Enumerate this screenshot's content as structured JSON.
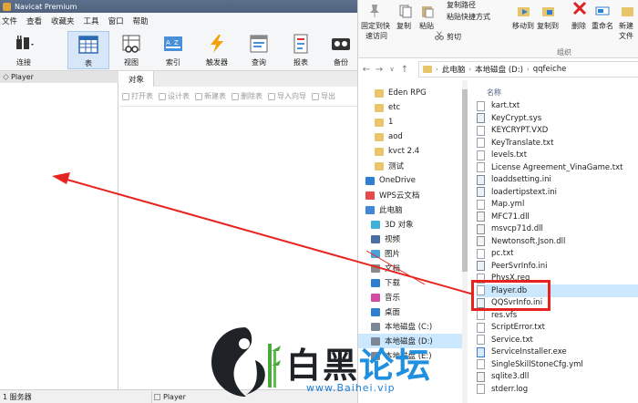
{
  "navicat": {
    "title": "Navicat Premium",
    "menu": [
      "文件",
      "查看",
      "收藏夹",
      "工具",
      "窗口",
      "帮助"
    ],
    "toolbar": [
      {
        "label": "连接",
        "icon": "connection-plug-icon"
      },
      {
        "label": "表",
        "icon": "table-grid-icon",
        "active": true
      },
      {
        "label": "视图",
        "icon": "view-glasses-icon"
      },
      {
        "label": "索引",
        "icon": "index-az-icon"
      },
      {
        "label": "触发器",
        "icon": "trigger-bolt-icon"
      },
      {
        "label": "查询",
        "icon": "query-table-icon"
      },
      {
        "label": "报表",
        "icon": "report-icon"
      },
      {
        "label": "备份",
        "icon": "backup-tape-icon"
      }
    ],
    "connection_tab": "Player",
    "object_tab": "对象",
    "object_actions": [
      "打开表",
      "设计表",
      "新建表",
      "删除表",
      "导入向导",
      "导出"
    ],
    "status": {
      "servers": "1 服务器",
      "db": "Player"
    }
  },
  "explorer": {
    "ribbon": {
      "pin_label_1": "固定到快",
      "pin_label_2": "速访问",
      "copy": "复制",
      "paste": "粘贴",
      "copy_path": "复制路径",
      "paste_shortcut": "粘贴快捷方式",
      "cut": "剪切",
      "move_to": "移动到",
      "copy_to": "复制到",
      "delete": "删除",
      "rename": "重命名",
      "new": "新建",
      "new_sub": "文件",
      "organize": "组织"
    },
    "address": [
      "此电脑",
      "本地磁盘 (D:)",
      "qqfeiche"
    ],
    "nav": [
      {
        "label": "Eden RPG",
        "kind": "folder"
      },
      {
        "label": "etc",
        "kind": "folder"
      },
      {
        "label": "1",
        "kind": "folder"
      },
      {
        "label": "aod",
        "kind": "folder"
      },
      {
        "label": "kvct 2.4",
        "kind": "folder"
      },
      {
        "label": "测试",
        "kind": "folder"
      },
      {
        "label": "OneDrive",
        "kind": "cloud"
      },
      {
        "label": "WPS云文档",
        "kind": "wps"
      },
      {
        "label": "此电脑",
        "kind": "pc"
      },
      {
        "label": "3D 对象",
        "kind": "3d"
      },
      {
        "label": "视频",
        "kind": "video"
      },
      {
        "label": "图片",
        "kind": "picture"
      },
      {
        "label": "文档",
        "kind": "doc"
      },
      {
        "label": "下载",
        "kind": "download"
      },
      {
        "label": "音乐",
        "kind": "music"
      },
      {
        "label": "桌面",
        "kind": "desktop"
      },
      {
        "label": "本地磁盘 (C:)",
        "kind": "drive"
      },
      {
        "label": "本地磁盘 (D:)",
        "kind": "drive",
        "selected": true
      },
      {
        "label": "本地磁盘 (E:)",
        "kind": "drive"
      }
    ],
    "column_name": "名称",
    "files": [
      {
        "name": "kart.txt",
        "type": "txt"
      },
      {
        "name": "KeyCrypt.sys",
        "type": "gear"
      },
      {
        "name": "KEYCRYPT.VXD",
        "type": "txt"
      },
      {
        "name": "KeyTranslate.txt",
        "type": "txt"
      },
      {
        "name": "levels.txt",
        "type": "txt"
      },
      {
        "name": "License Agreement_VinaGame.txt",
        "type": "txt"
      },
      {
        "name": "loaddsetting.ini",
        "type": "gear"
      },
      {
        "name": "loadertipstext.ini",
        "type": "gear"
      },
      {
        "name": "Map.yml",
        "type": "txt"
      },
      {
        "name": "MFC71.dll",
        "type": "dll"
      },
      {
        "name": "msvcp71d.dll",
        "type": "dll"
      },
      {
        "name": "Newtonsoft.Json.dll",
        "type": "dll"
      },
      {
        "name": "pc.txt",
        "type": "txt"
      },
      {
        "name": "PeerSvrInfo.ini",
        "type": "gear"
      },
      {
        "name": "PhysX.reg",
        "type": "txt"
      },
      {
        "name": "Player.db",
        "type": "txt",
        "selected": true
      },
      {
        "name": "QQSvrInfo.ini",
        "type": "gear"
      },
      {
        "name": "res.vfs",
        "type": "txt"
      },
      {
        "name": "ScriptError.txt",
        "type": "txt"
      },
      {
        "name": "Service.txt",
        "type": "txt"
      },
      {
        "name": "ServiceInstaller.exe",
        "type": "exe"
      },
      {
        "name": "SingleSkillStoneCfg.yml",
        "type": "txt"
      },
      {
        "name": "sqlite3.dll",
        "type": "dll"
      },
      {
        "name": "stderr.log",
        "type": "txt"
      }
    ]
  },
  "watermark": {
    "chars": [
      "白",
      "黑",
      "论",
      "坛"
    ],
    "url": "www.Baihei.vip"
  },
  "colors": {
    "annotation_red": "#e8231f",
    "selection_blue": "#cce8ff",
    "watermark_blue": "#1f8fe0"
  }
}
